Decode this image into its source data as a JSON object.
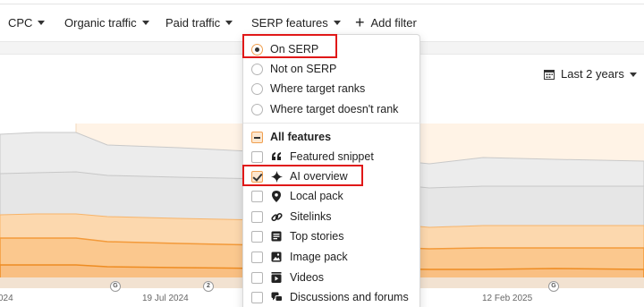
{
  "filters": {
    "cpc": "CPC",
    "organic_traffic": "Organic traffic",
    "paid_traffic": "Paid traffic",
    "serp_features": "SERP features",
    "add_filter": "Add filter"
  },
  "date_range": "Last 2 years",
  "serp_dropdown": {
    "position_options": [
      {
        "label": "On SERP",
        "selected": true
      },
      {
        "label": "Not on SERP",
        "selected": false
      },
      {
        "label": "Where target ranks",
        "selected": false
      },
      {
        "label": "Where target doesn't rank",
        "selected": false
      }
    ],
    "all_features_label": "All features",
    "features": [
      {
        "label": "Featured snippet",
        "icon": "quote-icon",
        "checked": false
      },
      {
        "label": "AI overview",
        "icon": "sparkle-icon",
        "checked": true
      },
      {
        "label": "Local pack",
        "icon": "map-pin-icon",
        "checked": false
      },
      {
        "label": "Sitelinks",
        "icon": "link-icon",
        "checked": false
      },
      {
        "label": "Top stories",
        "icon": "newspaper-icon",
        "checked": false
      },
      {
        "label": "Image pack",
        "icon": "image-icon",
        "checked": false
      },
      {
        "label": "Videos",
        "icon": "video-icon",
        "checked": false
      },
      {
        "label": "Discussions and forums",
        "icon": "chat-icon",
        "checked": false
      }
    ]
  },
  "chart": {
    "x_labels": [
      "024",
      "19 Jul 2024",
      "12 Feb 2025"
    ],
    "markers": [
      "G",
      "2",
      "G"
    ],
    "colors": {
      "highlight": "#e01818",
      "accent_orange": "#f0a050",
      "band_dark_orange": "#ee8c22",
      "band_light_orange": "#fbd9ae",
      "band_gray": "#e3e3e3"
    }
  }
}
